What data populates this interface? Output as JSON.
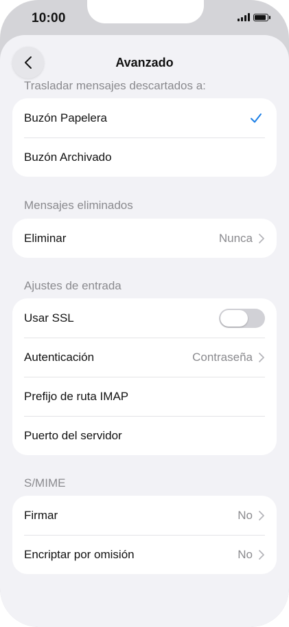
{
  "status": {
    "time": "10:00"
  },
  "nav": {
    "title": "Avanzado"
  },
  "sections": {
    "discarded": {
      "header": "Trasladar mensajes descartados a:",
      "rows": [
        {
          "label": "Buzón Papelera",
          "selected": true
        },
        {
          "label": "Buzón Archivado",
          "selected": false
        }
      ]
    },
    "deleted": {
      "header": "Mensajes eliminados",
      "rows": [
        {
          "label": "Eliminar",
          "value": "Nunca"
        }
      ]
    },
    "incoming": {
      "header": "Ajustes de entrada",
      "rows": [
        {
          "label": "Usar SSL",
          "toggle_on": false
        },
        {
          "label": "Autenticación",
          "value": "Contraseña"
        },
        {
          "label": "Prefijo de ruta IMAP"
        },
        {
          "label": "Puerto del servidor"
        }
      ]
    },
    "smime": {
      "header": "S/MIME",
      "rows": [
        {
          "label": "Firmar",
          "value": "No"
        },
        {
          "label": "Encriptar por omisión",
          "value": "No"
        }
      ]
    }
  },
  "colors": {
    "accent": "#1a7ee6",
    "background": "#f2f2f6",
    "secondary_text": "#8a8a8e",
    "toggle_off": "#d1d1d6"
  }
}
